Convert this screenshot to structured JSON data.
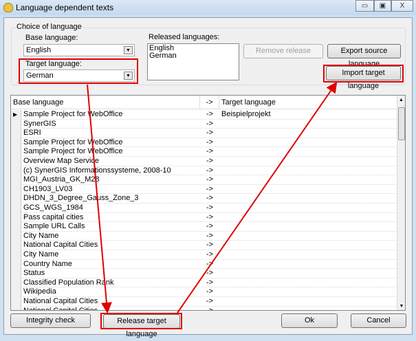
{
  "window": {
    "title": "Language dependent texts",
    "minimize": "▭",
    "maximize": "▣",
    "close": "X"
  },
  "group": {
    "label": "Choice of language",
    "base_label": "Base language:",
    "base_value": "English",
    "target_label": "Target language:",
    "target_value": "German",
    "released_label": "Released languages:",
    "released": [
      "English",
      "German"
    ],
    "remove_release": "Remove release",
    "export_source": "Export source language",
    "import_target": "Import target language"
  },
  "grid": {
    "headers": [
      "Base language",
      "->",
      "Target language"
    ],
    "rows": [
      [
        "Sample Project for WebOffice",
        "->",
        "Beispielprojekt"
      ],
      [
        "SynerGIS",
        "->",
        ""
      ],
      [
        "ESRI",
        "->",
        ""
      ],
      [
        "Sample Project for WebOffice",
        "->",
        ""
      ],
      [
        "Sample Project for WebOffice",
        "->",
        ""
      ],
      [
        "Overview Map Service",
        "->",
        ""
      ],
      [
        "(c) SynerGIS Informationssysteme, 2008-10",
        "->",
        ""
      ],
      [
        "MGI_Austria_GK_M28",
        "->",
        ""
      ],
      [
        "CH1903_LV03",
        "->",
        ""
      ],
      [
        "DHDN_3_Degree_Gauss_Zone_3",
        "->",
        ""
      ],
      [
        "GCS_WGS_1984",
        "->",
        ""
      ],
      [
        "Pass capital cities",
        "->",
        ""
      ],
      [
        "Sample URL Calls",
        "->",
        ""
      ],
      [
        "City Name",
        "->",
        ""
      ],
      [
        "National Capital Cities",
        "->",
        ""
      ],
      [
        "City Name",
        "->",
        ""
      ],
      [
        "Country Name",
        "->",
        ""
      ],
      [
        "Status",
        "->",
        ""
      ],
      [
        "Classified Population Rank",
        "->",
        ""
      ],
      [
        "Wikipedia",
        "->",
        ""
      ],
      [
        "National Capital Cities",
        "->",
        ""
      ],
      [
        "National Capital Cities",
        "->",
        ""
      ]
    ]
  },
  "buttons": {
    "integrity": "Integrity check",
    "release": "Release target language",
    "ok": "Ok",
    "cancel": "Cancel"
  },
  "colors": {
    "highlight": "#e00000"
  }
}
